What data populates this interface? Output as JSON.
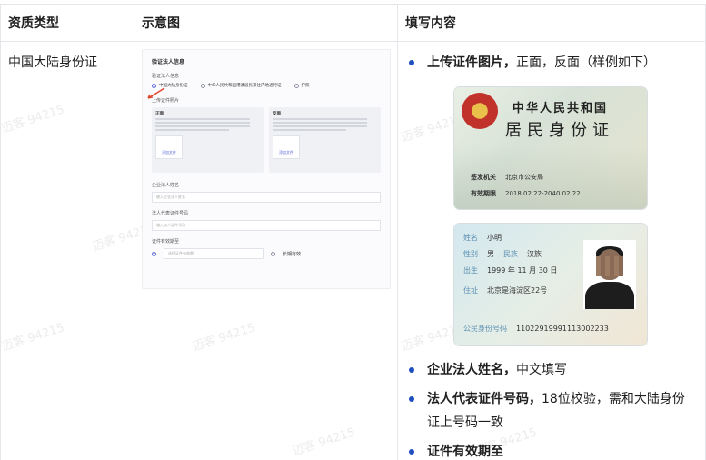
{
  "table": {
    "headers": [
      "资质类型",
      "示意图",
      "填写内容"
    ],
    "row": {
      "type": "中国大陆身份证"
    }
  },
  "watermark": "迈客 94215",
  "mock_form": {
    "title": "验证法人信息",
    "doc_label": "验证法人信息",
    "options": [
      "中国大陆身份证",
      "中华人民共和国港澳居民来往内地通行证",
      "护照"
    ],
    "upload_label": "上传证件照片",
    "front": "正面",
    "back": "反面",
    "upload_btn": "添加文件",
    "name_label": "企业法人姓名",
    "name_placeholder": "输入企业法人姓名",
    "id_label": "法人代表证件号码",
    "id_placeholder": "输入法人证件号码",
    "expiry_label": "证件有效期至",
    "expiry_placeholder": "选择证件有效期",
    "long_term": "长期有效"
  },
  "content": {
    "item1_bold": "上传证件图片，",
    "item1_text": "正面，反面（样例如下）",
    "item2_bold": "企业法人姓名，",
    "item2_text": "中文填写",
    "item3_bold": "法人代表证件号码，",
    "item3_text": "18位校验，需和大陆身份证上号码一致",
    "item4_bold": "证件有效期至"
  },
  "id_front": {
    "country": "中华人民共和国",
    "title": "居民身份证",
    "authority_label": "签发机关",
    "authority": "北京市公安局",
    "valid_label": "有效期限",
    "valid": "2018.02.22-2040.02.22"
  },
  "id_back": {
    "name_label": "姓名",
    "name": "小明",
    "sex_label": "性别",
    "sex": "男",
    "ethnic_label": "民族",
    "ethnic": "汉族",
    "birth_label": "出生",
    "birth": "1999 年 11 月 30 日",
    "addr_label": "住址",
    "addr": "北京是海淀区22号",
    "idno_label": "公民身份号码",
    "idno": "110229199911130022​33"
  }
}
